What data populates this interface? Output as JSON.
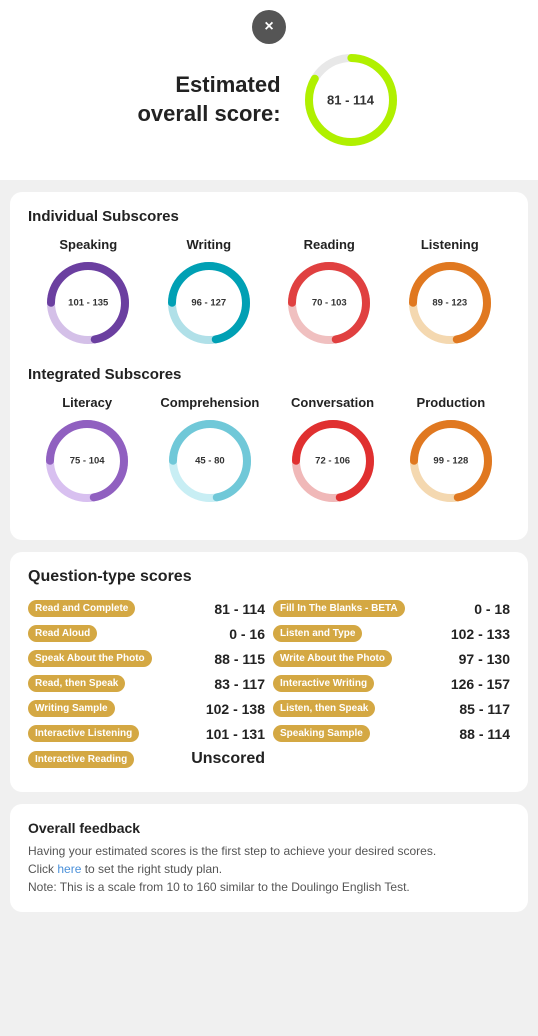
{
  "header": {
    "close_label": "×",
    "title": "Estimated\noverall score:",
    "overall_score": "81 - 114"
  },
  "individual_subscores": {
    "title": "Individual Subscores",
    "items": [
      {
        "label": "Speaking",
        "score": "101 - 135",
        "color": "#6b3fa0",
        "track_color": "#d4c0e8"
      },
      {
        "label": "Writing",
        "score": "96 - 127",
        "color": "#00a0b4",
        "track_color": "#b0e0e8"
      },
      {
        "label": "Reading",
        "score": "70 - 103",
        "color": "#e04040",
        "track_color": "#f0c0c0"
      },
      {
        "label": "Listening",
        "score": "89 - 123",
        "color": "#e07820",
        "track_color": "#f4d8b0"
      }
    ]
  },
  "integrated_subscores": {
    "title": "Integrated Subscores",
    "items": [
      {
        "label": "Literacy",
        "score": "75 - 104",
        "color": "#9060c0",
        "track_color": "#d8c0f0"
      },
      {
        "label": "Comprehension",
        "score": "45 - 80",
        "color": "#70c8d8",
        "track_color": "#c8eef4"
      },
      {
        "label": "Conversation",
        "score": "72 - 106",
        "color": "#e03030",
        "track_color": "#f0b8b8"
      },
      {
        "label": "Production",
        "score": "99 - 128",
        "color": "#e07820",
        "track_color": "#f4d8b0"
      }
    ]
  },
  "question_type_scores": {
    "title": "Question-type scores",
    "rows_left": [
      {
        "tag": "Read and Complete",
        "score": "81 - 114"
      },
      {
        "tag": "Read Aloud",
        "score": "0 - 16"
      },
      {
        "tag": "Speak About the Photo",
        "score": "88 - 115"
      },
      {
        "tag": "Read, then Speak",
        "score": "83 - 117"
      },
      {
        "tag": "Writing Sample",
        "score": "102 - 138"
      },
      {
        "tag": "Interactive Listening",
        "score": "101 - 131"
      },
      {
        "tag": "Interactive Reading",
        "score": "Unscored"
      }
    ],
    "rows_right": [
      {
        "tag": "Fill In The Blanks - BETA",
        "score": "0 - 18"
      },
      {
        "tag": "Listen and Type",
        "score": "102 - 133"
      },
      {
        "tag": "Write About the Photo",
        "score": "97 - 130"
      },
      {
        "tag": "Interactive Writing",
        "score": "126 - 157"
      },
      {
        "tag": "Listen, then Speak",
        "score": "85 - 117"
      },
      {
        "tag": "Speaking Sample",
        "score": "88 - 114"
      }
    ]
  },
  "feedback": {
    "title": "Overall feedback",
    "line1": "Having your estimated scores is the first step to achieve your desired scores.",
    "line2_pre": "Click ",
    "link_text": "here",
    "line2_post": " to set the right study plan.",
    "line3": "Note: This is a scale from 10 to 160 similar to the Doulingo English Test."
  }
}
